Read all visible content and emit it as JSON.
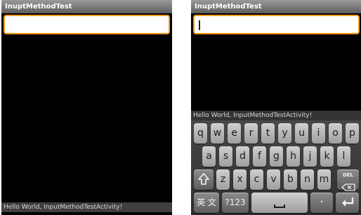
{
  "app_title": "InuptMethodTest",
  "status_text": "Hello World, InputMethodTestActivity!",
  "keyboard": {
    "row1": [
      "q",
      "w",
      "e",
      "r",
      "t",
      "y",
      "u",
      "i",
      "o",
      "p"
    ],
    "row2": [
      "a",
      "s",
      "d",
      "f",
      "g",
      "h",
      "j",
      "k",
      "l"
    ],
    "row3": [
      "z",
      "x",
      "c",
      "v",
      "b",
      "n",
      "m"
    ],
    "shift_icon": "shift-arrow-icon",
    "delete_label": "DEL",
    "delete_icon": "backspace-icon",
    "lang_label": "英 文",
    "symbols_label": "?123",
    "space_icon": "space-bar-icon",
    "period_label": "·",
    "enter_icon": "enter-arrow-icon"
  },
  "colors": {
    "field_border": "#ff9a1e",
    "background": "#000000",
    "title_bar": "#7a7a7a"
  }
}
